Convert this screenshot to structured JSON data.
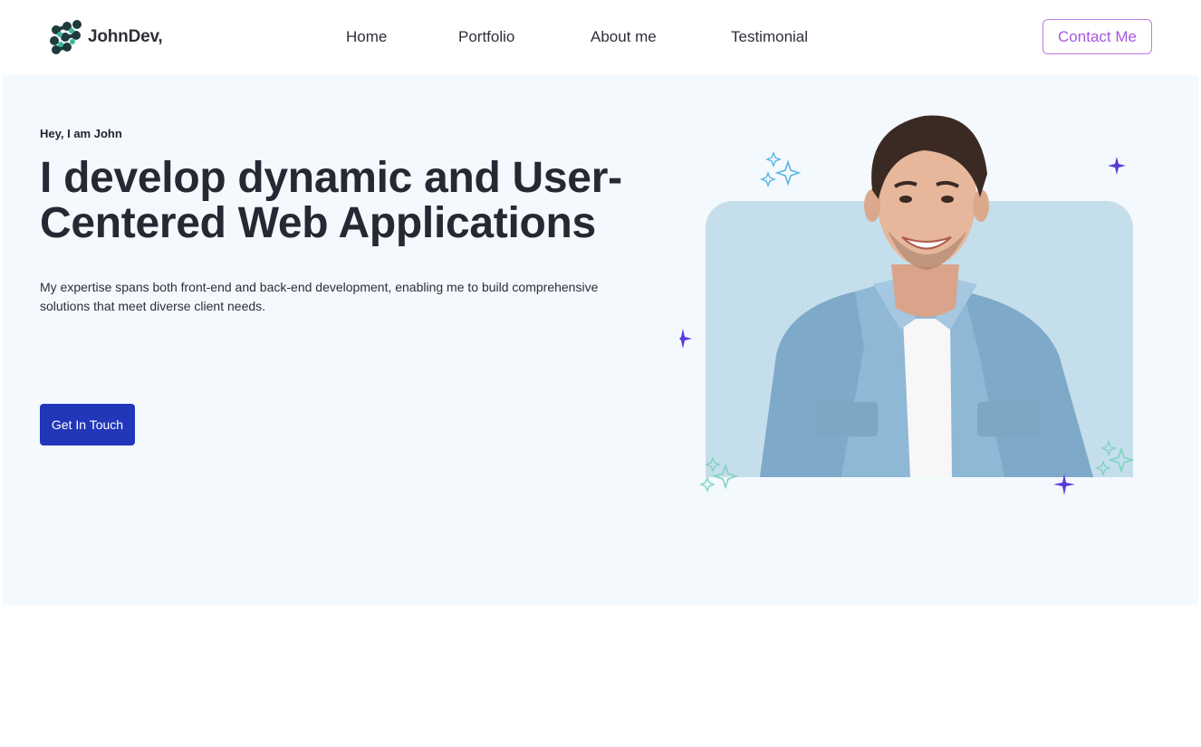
{
  "nav": {
    "brand": "JohnDev,",
    "links": [
      "Home",
      "Portfolio",
      "About me",
      "Testimonial"
    ],
    "contact_label": "Contact Me"
  },
  "hero": {
    "greeting": "Hey, I am John",
    "headline": "I develop dynamic and User-Centered Web Applications",
    "description": "My expertise spans both front-end and back-end development, enabling me to build comprehensive solutions that meet diverse client needs.",
    "cta_label": "Get In Touch"
  },
  "icons": {
    "logo": "dna-logo-icon",
    "decorations": [
      "sparkle-icon",
      "star-icon"
    ]
  },
  "colors": {
    "accent_primary": "#2136b8",
    "accent_outline": "#a857e0",
    "hero_background": "#f3f9fd",
    "card_background": "#c5deeb",
    "star_purple": "#5a3bd9",
    "sparkle_teal": "#7ed4c2"
  }
}
